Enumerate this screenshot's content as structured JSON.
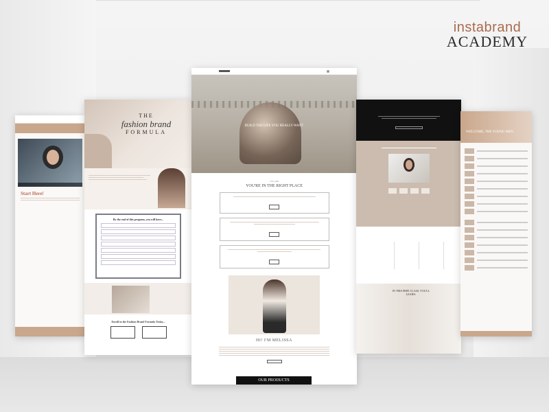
{
  "brand": {
    "top": "instabrand",
    "bottom": "ACADEMY"
  },
  "panel1": {
    "start": "Start Here!"
  },
  "panel2": {
    "title_line1": "THE",
    "title_line2": "fashion brand",
    "title_line3": "FORMULA",
    "box_title": "By the end of this program, you will have...",
    "enroll_title": "Enroll in the Fashion Brand Formula Today..."
  },
  "panel3": {
    "hero_text": "BUILD THE LIFE YOU REALLY WANT",
    "kicker": "YOU ARE",
    "heading": "YOU'RE IN THE RIGHT PLACE",
    "hi": "HI! I'M MELISSA",
    "products": "OUR PRODUCTS"
  },
  "panel4": {
    "learn": "IN THIS FREE CLASS, YOU'LL LEARN:"
  },
  "panel5": {
    "welcome": "WELCOME, THE YOUNG MEN"
  }
}
